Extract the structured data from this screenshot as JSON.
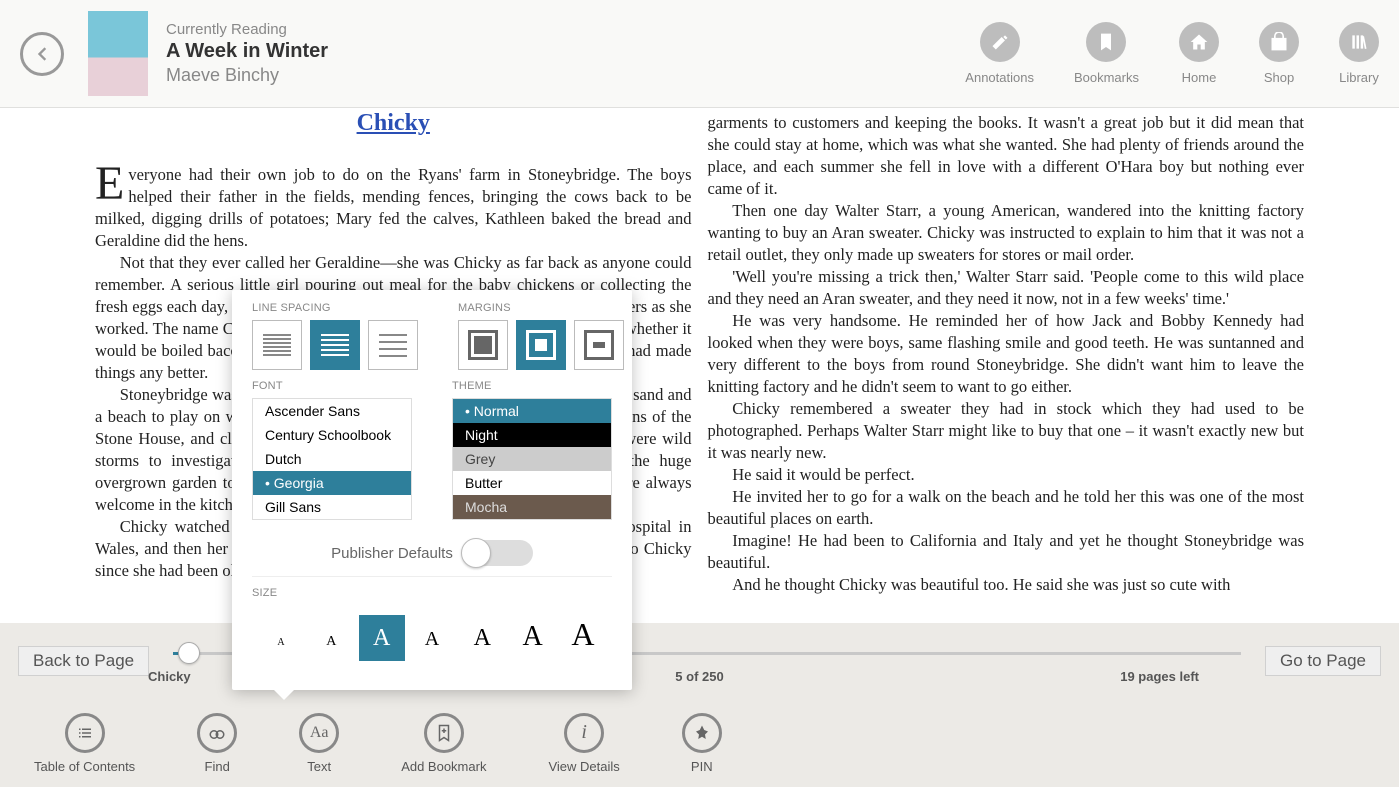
{
  "header": {
    "status": "Currently Reading",
    "title": "A Week in Winter",
    "author": "Maeve Binchy",
    "actions": [
      {
        "label": "Annotations"
      },
      {
        "label": "Bookmarks"
      },
      {
        "label": "Home"
      },
      {
        "label": "Shop"
      },
      {
        "label": "Library"
      }
    ]
  },
  "chapterTitle": "Chicky",
  "leftPage": {
    "p1": "Everyone had their own job to do on the Ryans' farm in Stoneybridge. The boys helped their father in the fields, mending fences, bringing the cows back to be milked, digging drills of potatoes; Mary fed the calves, Kathleen baked the bread and Geraldine did the hens.",
    "p2": "Not that they ever called her Geraldine—she was Chicky as far back as anyone could remember. A serious little girl pouring out meal for the baby chickens or collecting the fresh eggs each day, always saying 'chuck chuck chuck' soothingly into the feathers as she worked. The name Chicky stayed with her. The hens, and no one could tell you whether it would be boiled bacon or not for lunch. They always pretended Chicky herself had made things any better.",
    "p3": "Stoneybridge was a paradise for children during the summer, but the sun and sand and a beach to play on was a long, wild and lonely on the shore; there were the ruins of the Stone House, and cliffs to climb, birds' nests to discover, and in winter there were wild storms to investigate. And there were caves to explore. The Ryans had the huge overgrown garden to play in, and otherwise they ran round the house, and were always welcome in the kitchen.",
    "p4": "Chicky watched the others go, her elder sisters to train as nurses in a hospital in Wales, and then her brothers to serve their time doing whatever jobs appealed to Chicky since she had been old enough to comb the land"
  },
  "rightPage": {
    "p1": "garments to customers and keeping the books. It wasn't a great job but it did mean that she could stay at home, which was what she wanted. She had plenty of friends around the place, and each summer she fell in love with a different O'Hara boy but nothing ever came of it.",
    "p2": "Then one day Walter Starr, a young American, wandered into the knitting factory wanting to buy an Aran sweater. Chicky was instructed to explain to him that it was not a retail outlet, they only made up sweaters for stores or mail order.",
    "p3": "'Well you're missing a trick then,' Walter Starr said. 'People come to this wild place and they need an Aran sweater, and they need it now, not in a few weeks' time.'",
    "p4": "He was very handsome. He reminded her of how Jack and Bobby Kennedy had looked when they were boys, same flashing smile and good teeth. He was suntanned and very different to the boys from round Stoneybridge. She didn't want him to leave the knitting factory and he didn't seem to want to go either.",
    "p5": "Chicky remembered a sweater they had in stock which they had used to be photographed. Perhaps Walter Starr might like to buy that one – it wasn't exactly new but it was nearly new.",
    "p6": "He said it would be perfect.",
    "p7": "He invited her to go for a walk on the beach and he told her this was one of the most beautiful places on earth.",
    "p8": "Imagine! He had been to California and Italy and yet he thought Stoneybridge was beautiful.",
    "p9": "And he thought Chicky was beautiful too. He said she was just so cute with"
  },
  "progress": {
    "backBtn": "Back to Page",
    "chapter": "Chicky",
    "pageCount": "5 of 250",
    "pagesLeft": "19 pages left",
    "goBtn": "Go to Page"
  },
  "toolbar": [
    {
      "label": "Table of Contents"
    },
    {
      "label": "Find"
    },
    {
      "label": "Text"
    },
    {
      "label": "Add Bookmark"
    },
    {
      "label": "View Details"
    },
    {
      "label": "PIN"
    }
  ],
  "settings": {
    "lineSpacingLabel": "LINE SPACING",
    "marginsLabel": "MARGINS",
    "fontLabel": "FONT",
    "themeLabel": "THEME",
    "fonts": [
      "Ascender Sans",
      "Century Schoolbook",
      "Dutch",
      "Georgia",
      "Gill Sans"
    ],
    "fontSelected": "Georgia",
    "themes": [
      "Normal",
      "Night",
      "Grey",
      "Butter",
      "Mocha"
    ],
    "themeSelected": "Normal",
    "pubDefaults": "Publisher Defaults",
    "sizeLabel": "SIZE",
    "sizes": [
      10,
      13,
      22,
      18,
      22,
      26,
      30
    ],
    "sizeSelectedIndex": 2
  }
}
